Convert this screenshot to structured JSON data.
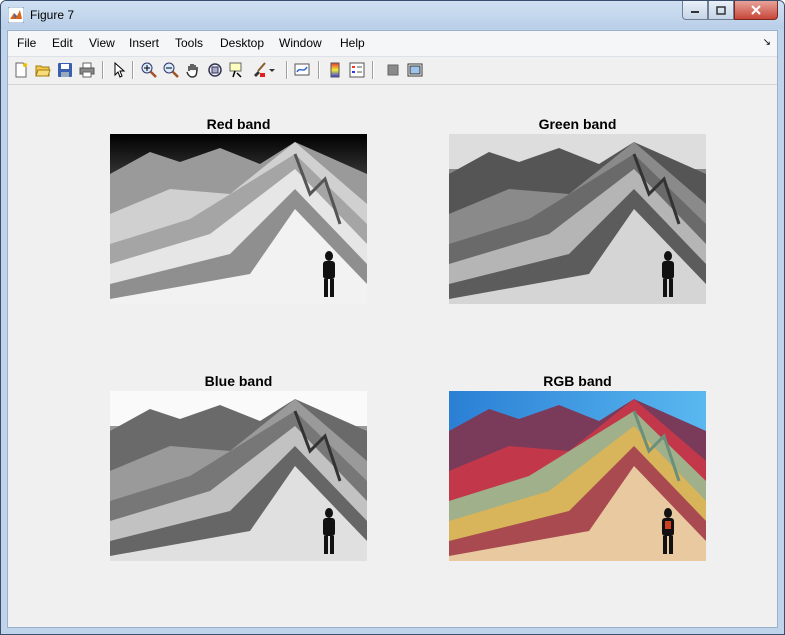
{
  "window": {
    "title": "Figure 7"
  },
  "menu": [
    "File",
    "Edit",
    "View",
    "Insert",
    "Tools",
    "Desktop",
    "Window",
    "Help"
  ],
  "toolbar_icons": [
    "new-figure-icon",
    "open-file-icon",
    "save-icon",
    "print-icon",
    "edit-plot-icon",
    "zoom-in-icon",
    "zoom-out-icon",
    "pan-icon",
    "rotate-3d-icon",
    "data-cursor-icon",
    "brush-icon",
    "brush-dropdown-icon",
    "link-plot-icon",
    "insert-colorbar-icon",
    "insert-legend-icon",
    "hide-plot-tools-icon",
    "show-plot-tools-icon"
  ],
  "panels": [
    {
      "title": "Red band",
      "mode": "red"
    },
    {
      "title": "Green band",
      "mode": "green"
    },
    {
      "title": "Blue band",
      "mode": "blue"
    },
    {
      "title": "RGB band",
      "mode": "rgb"
    }
  ],
  "colors": {
    "titlebar": "#bfd3ea",
    "client_bg": "#f0f0f0",
    "close_button": "#c7473a"
  }
}
